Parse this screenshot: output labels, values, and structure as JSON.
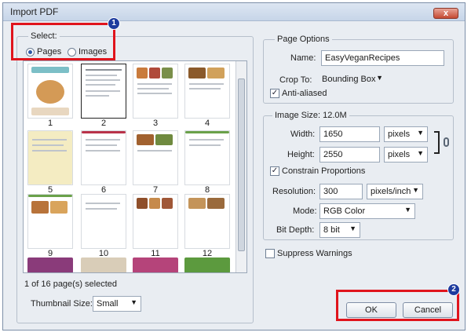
{
  "window": {
    "title": "Import PDF",
    "close_label": "x"
  },
  "select_group": {
    "legend": "Select:",
    "pages_label": "Pages",
    "images_label": "Images",
    "selected_option": "Pages"
  },
  "thumbnails": [
    {
      "number": "1",
      "selected": false
    },
    {
      "number": "2",
      "selected": true
    },
    {
      "number": "3",
      "selected": false
    },
    {
      "number": "4",
      "selected": false
    },
    {
      "number": "5",
      "selected": false
    },
    {
      "number": "6",
      "selected": false
    },
    {
      "number": "7",
      "selected": false
    },
    {
      "number": "8",
      "selected": false
    },
    {
      "number": "9",
      "selected": false
    },
    {
      "number": "10",
      "selected": false
    },
    {
      "number": "11",
      "selected": false
    },
    {
      "number": "12",
      "selected": false
    }
  ],
  "selection_status": "1 of 16 page(s) selected",
  "thumbnail_size": {
    "label": "Thumbnail Size:",
    "value": "Small"
  },
  "page_options": {
    "legend": "Page Options",
    "name_label": "Name:",
    "name_value": "EasyVeganRecipes",
    "crop_label": "Crop To:",
    "crop_value": "Bounding Box",
    "anti_aliased_label": "Anti-aliased",
    "anti_aliased_checked": true
  },
  "image_size": {
    "legend": "Image Size: 12.0M",
    "width_label": "Width:",
    "width_value": "1650",
    "width_unit": "pixels",
    "height_label": "Height:",
    "height_value": "2550",
    "height_unit": "pixels",
    "constrain_label": "Constrain Proportions",
    "constrain_checked": true,
    "resolution_label": "Resolution:",
    "resolution_value": "300",
    "resolution_unit": "pixels/inch",
    "mode_label": "Mode:",
    "mode_value": "RGB Color",
    "bit_depth_label": "Bit Depth:",
    "bit_depth_value": "8 bit"
  },
  "suppress_warnings_label": "Suppress Warnings",
  "buttons": {
    "ok": "OK",
    "cancel": "Cancel"
  },
  "annotations": {
    "badge_1": "1",
    "badge_2": "2"
  },
  "colors": {
    "highlight_box": "#e0141c",
    "badge": "#1d3b9e"
  }
}
